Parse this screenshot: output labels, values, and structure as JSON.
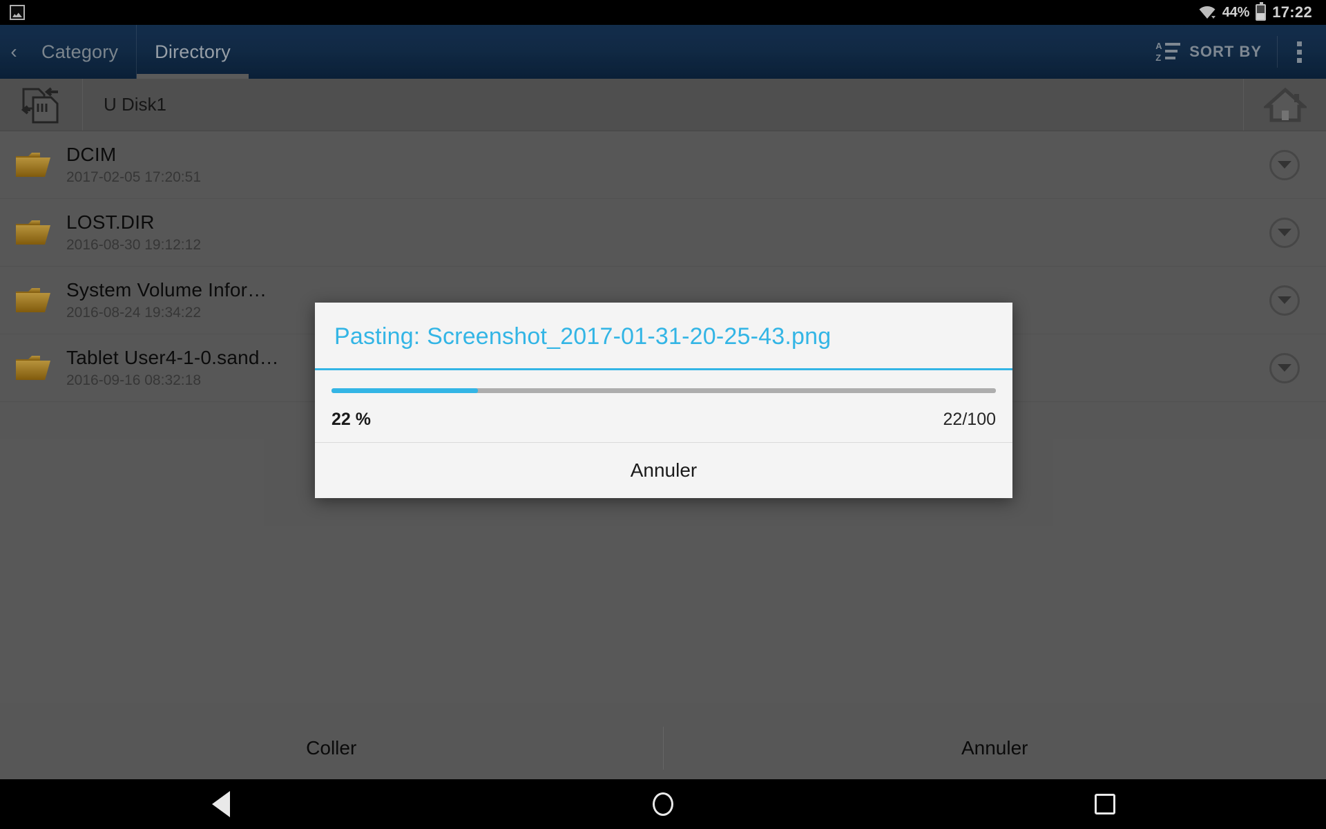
{
  "status_bar": {
    "notification_icon": "screenshot-image-icon",
    "wifi_icon": "wifi-icon",
    "battery_percent": "44%",
    "battery_icon": "battery-icon",
    "time": "17:22"
  },
  "action_bar": {
    "back_glyph": "‹",
    "tabs": [
      {
        "label": "Category",
        "active": false
      },
      {
        "label": "Directory",
        "active": true
      }
    ],
    "sort_by_label": "SORT BY",
    "sort_icon_top": "A",
    "sort_icon_bottom": "Z",
    "overflow_icon": "overflow-menu-icon"
  },
  "path_bar": {
    "up_icon": "go-up-directory-icon",
    "path": "U Disk1",
    "home_icon": "home-icon"
  },
  "file_list": {
    "rows": [
      {
        "name": "DCIM",
        "date": "2017-02-05 17:20:51",
        "icon": "folder-icon",
        "action_icon": "chevron-down-circle-icon"
      },
      {
        "name": "LOST.DIR",
        "date": "2016-08-30 19:12:12",
        "icon": "folder-icon",
        "action_icon": "chevron-down-circle-icon"
      },
      {
        "name": "System Volume Infor…",
        "date": "2016-08-24 19:34:22",
        "icon": "folder-icon",
        "action_icon": "chevron-down-circle-icon"
      },
      {
        "name": "Tablet User4-1-0.sand…",
        "date": "2016-09-16 08:32:18",
        "icon": "folder-icon",
        "action_icon": "chevron-down-circle-icon"
      }
    ]
  },
  "bottom_bar": {
    "paste_label": "Coller",
    "cancel_label": "Annuler"
  },
  "dialog": {
    "title": "Pasting: Screenshot_2017-01-31-20-25-43.png",
    "progress_percent": 22,
    "percent_label": "22 %",
    "count_label": "22/100",
    "cancel_label": "Annuler",
    "accent_color": "#33b5e5"
  },
  "nav_bar": {
    "back_icon": "nav-back-triangle-icon",
    "home_icon": "nav-home-circle-icon",
    "recents_icon": "nav-recents-square-icon"
  },
  "colors": {
    "accent": "#33b5e5",
    "action_bar": "#153354",
    "surface": "#6b6b6b",
    "folder": "#c8921f"
  }
}
